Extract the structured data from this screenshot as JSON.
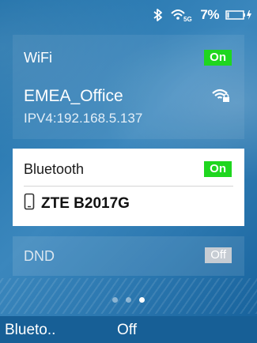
{
  "status_bar": {
    "bluetooth_icon": "bluetooth-icon",
    "wifi_icon": "wifi-5g-icon",
    "wifi_band": "5G",
    "battery_percent": "7%",
    "battery_icon": "battery-charging-icon"
  },
  "wifi": {
    "label": "WiFi",
    "state": "On",
    "network_name": "EMEA_Office",
    "ip": "IPV4:192.168.5.137",
    "signal_icon": "wifi-lock-icon"
  },
  "bluetooth": {
    "label": "Bluetooth",
    "state": "On",
    "device_icon": "phone-icon",
    "device_name": "ZTE B2017G"
  },
  "dnd": {
    "label": "DND",
    "state": "Off"
  },
  "pager": {
    "total": 3,
    "active_index": 2
  },
  "bottom_bar": {
    "label": "Blueto..",
    "value": "Off"
  },
  "colors": {
    "on_badge": "#1fd61f",
    "off_badge": "#c6ccd3",
    "background": "#2b77af"
  }
}
